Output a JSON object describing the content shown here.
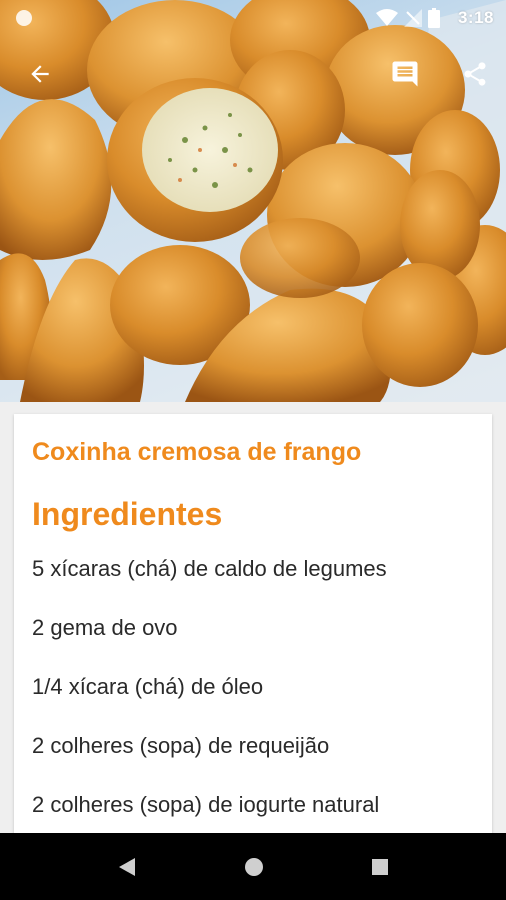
{
  "status_bar": {
    "time": "3:18",
    "icons": [
      "notification-dot-icon",
      "wifi-icon",
      "signal-icon",
      "battery-icon"
    ]
  },
  "toolbar": {
    "back_icon": "arrow-back-icon",
    "comment_icon": "comment-icon",
    "share_icon": "share-icon"
  },
  "hero": {
    "image": "fried coxinha snacks photo"
  },
  "recipe": {
    "title": "Coxinha cremosa de frango",
    "section_title": "Ingredientes",
    "ingredients": [
      "5 xícaras (chá) de caldo de legumes",
      "2 gema de ovo",
      "1/4 xícara (chá) de óleo",
      "2 colheres (sopa) de requeijão",
      "2 colheres (sopa) de iogurte natural"
    ]
  },
  "colors": {
    "accent": "#ef8a1d",
    "text": "#2a2a2a",
    "card": "#ffffff",
    "background": "#efefef",
    "navbar": "#000000"
  },
  "navbar": {
    "back_icon": "nav-back-icon",
    "home_icon": "nav-home-icon",
    "recent_icon": "nav-recents-icon"
  }
}
